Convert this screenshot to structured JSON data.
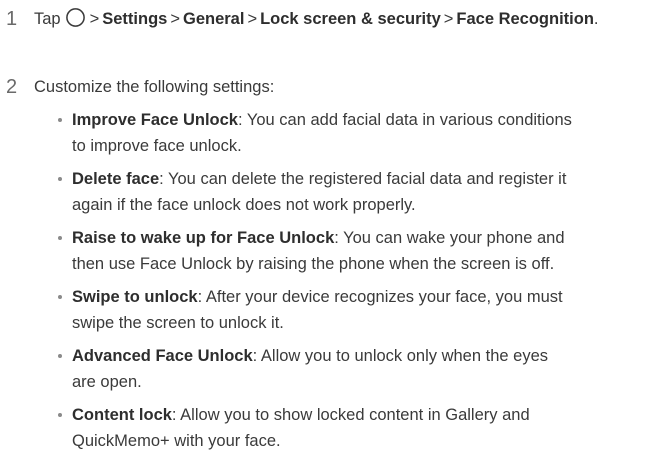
{
  "step1": {
    "number": "1",
    "tap": "Tap",
    "icon": "home-circle-icon",
    "separator": ">",
    "path": [
      "Settings",
      "General",
      "Lock screen & security",
      "Face Recognition"
    ],
    "end": "."
  },
  "step2": {
    "number": "2",
    "text": "Customize the following settings:"
  },
  "settings": [
    {
      "term": "Improve Face Unlock",
      "line1": ": You can add facial data in various conditions",
      "line2": "to improve face unlock."
    },
    {
      "term": "Delete face",
      "line1": ": You can delete the registered facial data and register it",
      "line2": "again if the face unlock does not work properly."
    },
    {
      "term": "Raise to wake up for Face Unlock",
      "line1": ": You can wake your phone and",
      "line2": "then use Face Unlock by raising the phone when the screen is off."
    },
    {
      "term": "Swipe to unlock",
      "line1": ": After your device recognizes your face, you must",
      "line2": "swipe the screen to unlock it."
    },
    {
      "term": "Advanced Face Unlock",
      "line1": ": Allow you to unlock only when the eyes",
      "line2": "are open."
    },
    {
      "term": "Content lock",
      "line1": ": Allow you to show locked content in Gallery and",
      "line2": "QuickMemo+ with your face."
    }
  ]
}
